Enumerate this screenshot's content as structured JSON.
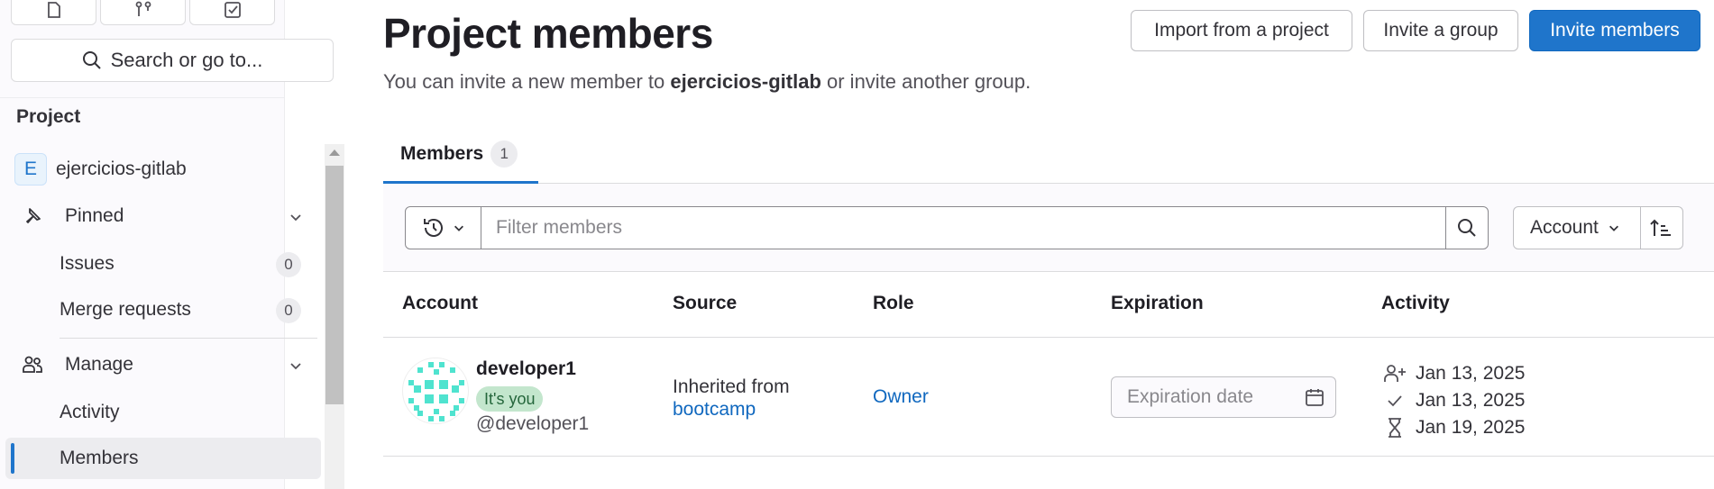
{
  "sidebar": {
    "search_label": "Search or go to...",
    "section_title": "Project",
    "project": {
      "initial": "E",
      "name": "ejercicios-gitlab"
    },
    "pinned": {
      "label": "Pinned",
      "items": [
        {
          "label": "Issues",
          "count": "0"
        },
        {
          "label": "Merge requests",
          "count": "0"
        }
      ]
    },
    "manage": {
      "label": "Manage",
      "items": [
        {
          "label": "Activity"
        },
        {
          "label": "Members"
        }
      ]
    }
  },
  "header": {
    "title": "Project members",
    "subtitle_prefix": "You can invite a new member to ",
    "subtitle_project": "ejercicios-gitlab",
    "subtitle_suffix": " or invite another group.",
    "buttons": {
      "import": "Import from a project",
      "invite_group": "Invite a group",
      "invite_members": "Invite members"
    }
  },
  "tabs": [
    {
      "label": "Members",
      "count": "1"
    }
  ],
  "filter": {
    "placeholder": "Filter members",
    "sort_label": "Account"
  },
  "table": {
    "columns": [
      "Account",
      "Source",
      "Role",
      "Expiration",
      "Activity"
    ],
    "rows": [
      {
        "name": "developer1",
        "badge": "It's you",
        "username": "@developer1",
        "source_prefix": "Inherited from",
        "source_link": "bootcamp",
        "role": "Owner",
        "expiration_placeholder": "Expiration date",
        "activity": [
          {
            "icon": "user-add-icon",
            "date": "Jan 13, 2025"
          },
          {
            "icon": "check-icon",
            "date": "Jan 13, 2025"
          },
          {
            "icon": "hourglass-icon",
            "date": "Jan 19, 2025"
          }
        ]
      }
    ]
  },
  "colors": {
    "primary": "#1f75cb",
    "link": "#1068bf",
    "badge_success_bg": "#c3e6cd",
    "identicon": "#4fe3cf"
  }
}
